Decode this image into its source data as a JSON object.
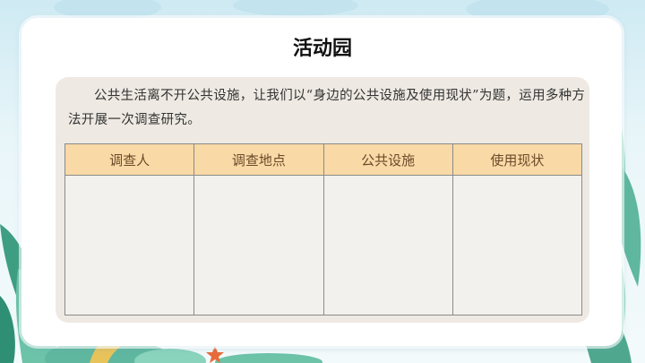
{
  "page": {
    "title": "活动园",
    "intro": "公共生活离不开公共设施，让我们以“身边的公共设施及使用现状”为题，运用多种方法开展一次调查研究。"
  },
  "table": {
    "headers": [
      "调查人",
      "调查地点",
      "公共设施",
      "使用现状"
    ],
    "rows": [
      [
        "",
        "",
        "",
        ""
      ]
    ]
  },
  "colors": {
    "header_bg": "#f9d9a6",
    "panel_bg": "#eeeae3",
    "sky": "#cfeaf3",
    "leaf": "#4fb39a"
  }
}
